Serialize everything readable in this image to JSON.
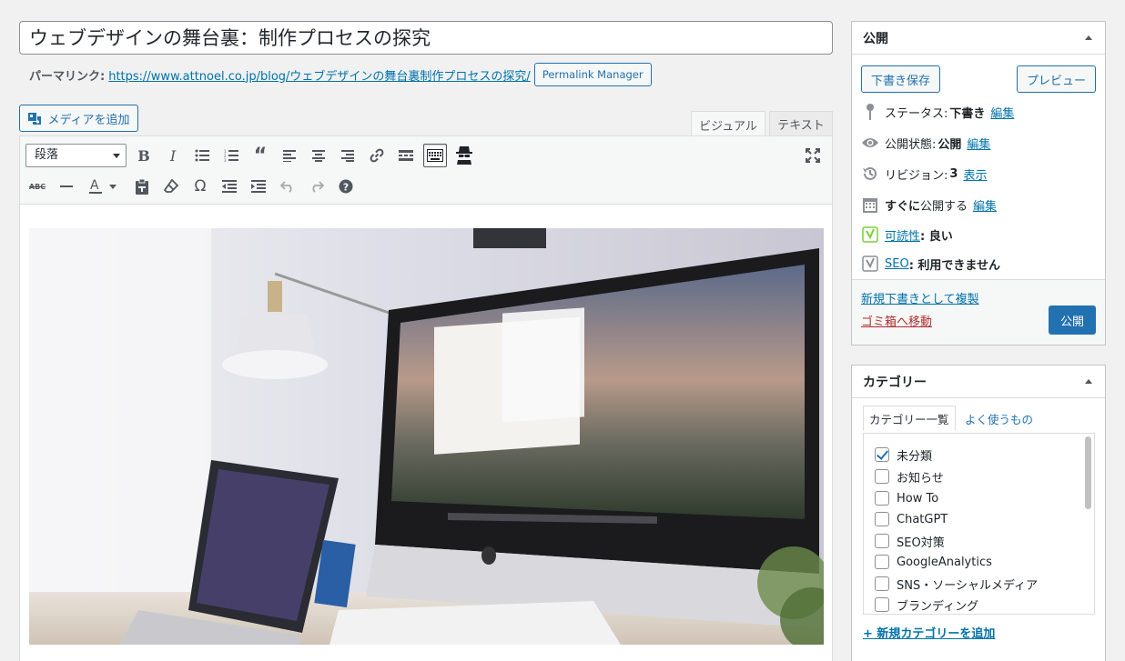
{
  "post": {
    "title": "ウェブデザインの舞台裏：制作プロセスの探究",
    "permalink_label": "パーマリンク:",
    "permalink_url": "https://www.attnoel.co.jp/blog/ウェブデザインの舞台裏制作プロセスの探究/",
    "permalink_manager_label": "Permalink Manager"
  },
  "editor": {
    "add_media_label": "メディアを追加",
    "tab_visual": "ビジュアル",
    "tab_text": "テキスト",
    "format_select": "段落",
    "icons": [
      "bold-icon",
      "italic-icon",
      "bulleted-list-icon",
      "numbered-list-icon",
      "blockquote-icon",
      "align-left-icon",
      "align-center-icon",
      "align-right-icon",
      "link-icon",
      "read-more-icon",
      "toolbar-toggle-icon",
      "spy-icon",
      "fullscreen-icon",
      "strikethrough-icon",
      "horizontal-line-icon",
      "text-color-icon",
      "paste-text-icon",
      "clear-formatting-icon",
      "special-character-icon",
      "outdent-icon",
      "indent-icon",
      "undo-icon",
      "redo-icon",
      "help-icon"
    ]
  },
  "publish": {
    "heading": "公開",
    "save_draft": "下書き保存",
    "preview": "プレビュー",
    "status_label": "ステータス:",
    "status_value": "下書き",
    "visibility_label": "公開状態:",
    "visibility_value": "公開",
    "revisions_label": "リビジョン:",
    "revisions_value": "3",
    "revisions_link": "表示",
    "schedule_bold": "すぐに",
    "schedule_text": "公開する",
    "edit_link": "編集",
    "readability_link": "可読性",
    "readability_value": ": 良い",
    "seo_link": "SEO",
    "seo_value": ": 利用できません",
    "duplicate_link": "新規下書きとして複製",
    "trash_link": "ゴミ箱へ移動",
    "publish_button": "公開",
    "colors": {
      "primary": "#2271b1",
      "trash": "#b32d2e",
      "yoast_good": "#7ad03a"
    }
  },
  "categories": {
    "heading": "カテゴリー",
    "tab_all": "カテゴリー一覧",
    "tab_popular": "よく使うもの",
    "items": [
      {
        "label": "未分類",
        "checked": true
      },
      {
        "label": "お知らせ",
        "checked": false
      },
      {
        "label": "How To",
        "checked": false
      },
      {
        "label": "ChatGPT",
        "checked": false
      },
      {
        "label": "SEO対策",
        "checked": false
      },
      {
        "label": "GoogleAnalytics",
        "checked": false
      },
      {
        "label": "SNS・ソーシャルメディア",
        "checked": false
      },
      {
        "label": "ブランディング",
        "checked": false
      }
    ],
    "add_new": "+ 新規カテゴリーを追加"
  }
}
